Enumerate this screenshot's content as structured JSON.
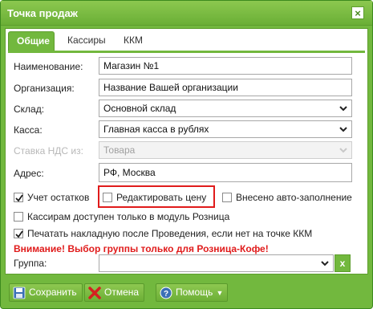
{
  "window": {
    "title": "Точка продаж",
    "close_glyph": "×"
  },
  "tabs": [
    {
      "label": "Общие",
      "active": true
    },
    {
      "label": "Кассиры",
      "active": false
    },
    {
      "label": "ККМ",
      "active": false
    }
  ],
  "form": {
    "name": {
      "label": "Наименование:",
      "value": "Магазин №1"
    },
    "organization": {
      "label": "Организация:",
      "value": "Название Вашей организации"
    },
    "warehouse": {
      "label": "Склад:",
      "value": "Основной склад"
    },
    "cashbox": {
      "label": "Касса:",
      "value": "Главная касса в рублях"
    },
    "vat": {
      "label": "Ставка НДС из:",
      "value": "Товара"
    },
    "address": {
      "label": "Адрес:",
      "value": "РФ, Москва"
    },
    "group": {
      "label": "Группа:",
      "value": ""
    }
  },
  "checkboxes": {
    "stock_tracking": {
      "label": "Учет остатков",
      "checked": true
    },
    "edit_price": {
      "label": "Редактировать цену",
      "checked": false
    },
    "auto_fill": {
      "label": "Внесено авто-заполнение",
      "checked": false
    },
    "retail_only": {
      "label": "Кассирам доступен только в модуль Розница",
      "checked": false
    },
    "print_invoice": {
      "label": "Печатать накладную после Проведения, если нет на точке ККМ",
      "checked": true
    }
  },
  "warning": "Внимание! Выбор группы только для Розница-Кофе!",
  "group_clear": "x",
  "footer": {
    "save": "Сохранить",
    "cancel": "Отмена",
    "help": "Помощь"
  },
  "colors": {
    "accent": "#72b83e",
    "highlight": "#e01b1b",
    "warning": "#e01b1b"
  }
}
